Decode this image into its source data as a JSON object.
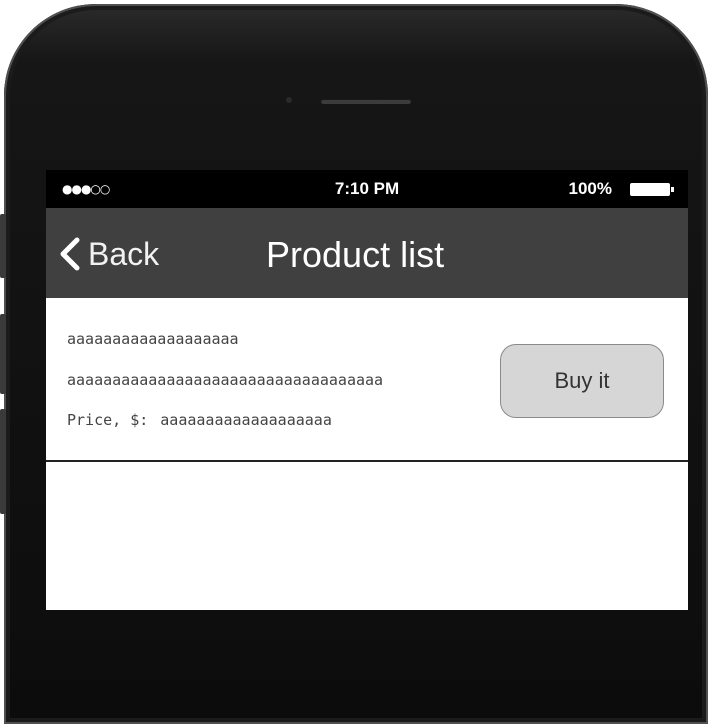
{
  "status_bar": {
    "signal": "●●●○○",
    "time": "7:10 PM",
    "battery_percent": "100%",
    "battery_level": 1.0
  },
  "nav_bar": {
    "back_label": "Back",
    "back_icon": "chevron-left-icon",
    "title": "Product list"
  },
  "product": {
    "line1": "aaaaaaaaaaaaaaaaaaa",
    "line2": "aaaaaaaaaaaaaaaaaaaaaaaaaaaaaaaaaaa",
    "price_label": "Price, $:",
    "price_value": "aaaaaaaaaaaaaaaaaaa",
    "buy_label": "Buy it"
  },
  "colors": {
    "nav_bar": "#404040",
    "status_bar": "#000000",
    "buy_button": "#d6d6d6"
  }
}
